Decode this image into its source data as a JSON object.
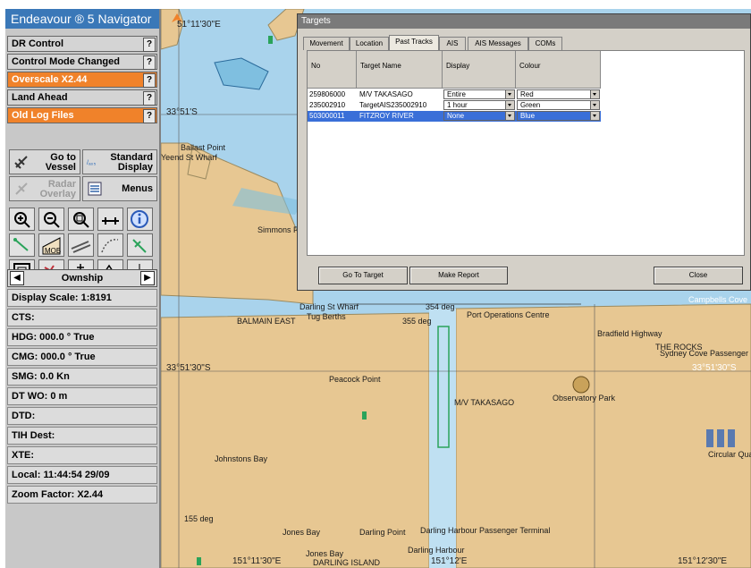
{
  "app_title": "Endeavour ® 5 Navigator",
  "alarms": [
    {
      "label": "DR Control",
      "status": "normal",
      "help": "?"
    },
    {
      "label": "Control Mode Changed",
      "status": "normal",
      "help": "?"
    },
    {
      "label": "Overscale X2.44",
      "status": "warning",
      "help": "?"
    },
    {
      "label": "Land Ahead",
      "status": "normal",
      "help": "?"
    },
    {
      "label": "Old Log Files",
      "status": "warning",
      "help": "?"
    }
  ],
  "buttons": {
    "go_to_vessel": "Go to\nVessel",
    "standard_display": "Standard\nDisplay",
    "radar_overlay": "Radar\nOverlay",
    "menus": "Menus",
    "standard_display_badge": "/ₐ₀₅"
  },
  "tools": [
    "zoom-in-icon",
    "zoom-out-icon",
    "zoom-area-icon",
    "measure-icon",
    "info-icon",
    "route-icon",
    "mob-icon",
    "chart-layer-icon",
    "track-icon",
    "cursor-icon",
    "frame-icon",
    "waypoint-icon",
    "anchor-icon",
    "layers-icon",
    "scale-icon"
  ],
  "tool_labels": {
    "mob": "MOB"
  },
  "nav": {
    "prev": "◀",
    "label": "Ownship",
    "next": "▶"
  },
  "status": [
    "Display Scale: 1:8191",
    "CTS:",
    "HDG: 000.0 ° True",
    "CMG: 000.0 ° True",
    "SMG: 0.0  Kn",
    "DT WO: 0  m",
    "DTD:",
    "TIH Dest:",
    "XTE:",
    "Local: 11:44:54 29/09",
    "Zoom Factor: X2.44"
  ],
  "chart": {
    "labels": [
      "51°11'30\"E",
      "33°51'S",
      "Ballast Point",
      "Yeend St Wharf",
      "Simmons P",
      "Darling St Wharf",
      "BALMAIN EAST",
      "Tug Berths",
      "354 deg",
      "355 deg",
      "Port Operations Centre",
      "Bradfield Highway",
      "THE ROCKS",
      "Sydney Cove Passenger",
      "33°51'30\"S",
      "33°51'30\"S",
      "Peacock Point",
      "Observatory Park",
      "M/V TAKASAGO",
      "Johnstons Bay",
      "155 deg",
      "Jones Bay",
      "Darling Point",
      "Darling Harbour Passenger Terminal",
      "Darling Harbour",
      "Jones Bay",
      "DARLING ISLAND",
      "151°11'30\"E",
      "151°12'E",
      "151°12'30\"E",
      "Campbells Cove",
      "Circular Quay"
    ],
    "colors": {
      "water": "#a9d3ec",
      "land": "#e7c792",
      "vessel": "#2aa35a",
      "shallow": "#7fbfe0"
    }
  },
  "dialog": {
    "title": "Targets",
    "tabs": [
      "Movement",
      "Location",
      "Past Tracks",
      "AIS",
      "AIS Messages",
      "COMs"
    ],
    "active_tab": "Past Tracks",
    "columns": [
      "No",
      "Target Name",
      "Display",
      "Colour"
    ],
    "rows": [
      {
        "no": "259806000",
        "name": "M/V TAKASAGO",
        "display": "Entire",
        "colour": "Red",
        "selected": false
      },
      {
        "no": "235002910",
        "name": "TargetAIS235002910",
        "display": "1 hour",
        "colour": "Green",
        "selected": false
      },
      {
        "no": "503000011",
        "name": "FITZROY RIVER",
        "display": "None",
        "colour": "Blue",
        "selected": true
      }
    ],
    "buttons": {
      "go_to_target": "Go To Target",
      "make_report": "Make Report",
      "close": "Close"
    }
  }
}
